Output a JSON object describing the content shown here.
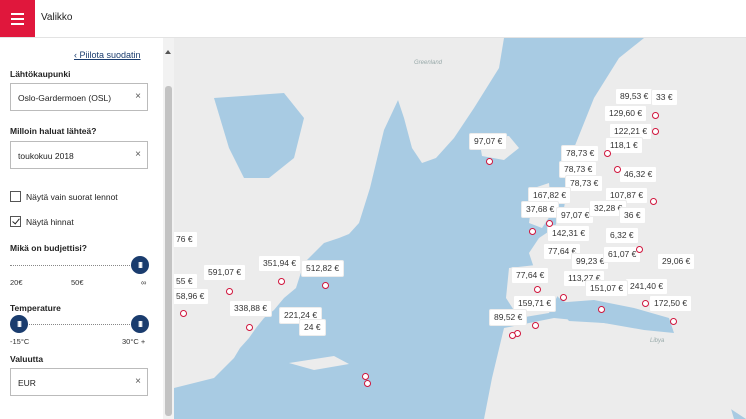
{
  "header": {
    "menu_label": "Valikko"
  },
  "sidebar": {
    "hide_filter": "Piilota suodatin",
    "origin": {
      "label": "Lähtökaupunki",
      "value": "Oslo-Gardermoen (OSL)"
    },
    "when": {
      "label": "Milloin haluat lähteä?",
      "value": "toukokuu 2018"
    },
    "direct_only": {
      "label": "Näytä vain suorat lennot",
      "checked": false
    },
    "show_prices": {
      "label": "Näytä hinnat",
      "checked": true
    },
    "budget": {
      "label": "Mikä on budjettisi?",
      "ticks": [
        "20€",
        "50€",
        "∞"
      ],
      "handle": "III"
    },
    "temperature": {
      "label": "Temperature",
      "min": "-15°C",
      "max": "30°C +",
      "handle": "III"
    },
    "currency": {
      "label": "Valuutta",
      "value": "EUR"
    },
    "clear_icon": "×"
  },
  "map": {
    "labels": {
      "greenland": "Greenland",
      "libya": "Libya"
    },
    "prices": [
      "97,07 €",
      "89,53 €",
      "129,60 €",
      "122,21 €",
      "118,1 €",
      "78,73 €",
      "78,73 €",
      "78,73 €",
      "46,32 €",
      "167,82 €",
      "107,87 €",
      "37,68 €",
      "97,07 €",
      "32,28 €",
      "36 €",
      "142,31 €",
      "6,32 €",
      "77,64 €",
      "99,23 €",
      "61,07 €",
      "29,06 €",
      "77,64 €",
      "113,27 €",
      "241,40 €",
      "159,71 €",
      "151,07 €",
      "172,50 €",
      "89,52 €",
      "76 €",
      "55 €",
      "58,96 €",
      "591,07 €",
      "351,94 €",
      "512,82 €",
      "338,88 €",
      "221,24 €",
      "24 €",
      "33 €"
    ]
  },
  "colors": {
    "accent": "#e0173c",
    "navy": "#1a3c6e",
    "water": "#a8cbe3",
    "land": "#ececec",
    "pin": "#d0143c"
  }
}
